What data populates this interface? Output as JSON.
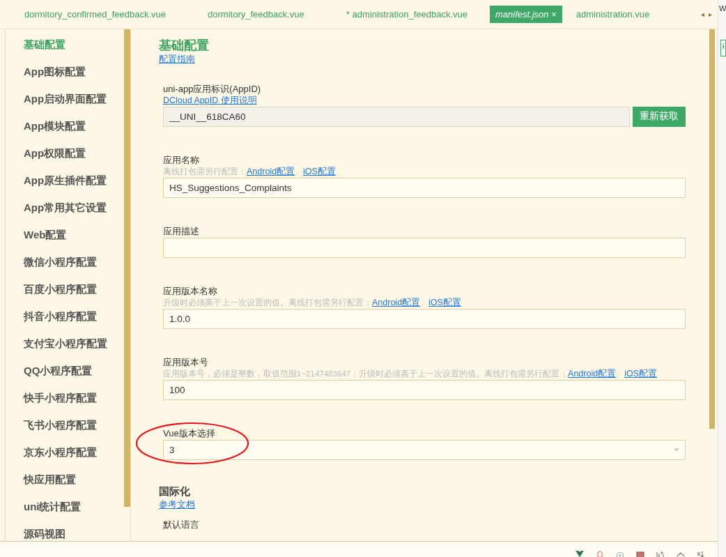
{
  "tabs": [
    {
      "label": "dormitory_confirmed_feedback.vue",
      "selected": false,
      "modified": false
    },
    {
      "label": "dormitory_feedback.vue",
      "selected": false,
      "modified": false
    },
    {
      "label": "administration_feedback.vue",
      "selected": false,
      "modified": true,
      "modified_mark": "*"
    },
    {
      "label": "manifest.json",
      "selected": true,
      "modified": false,
      "close": "×"
    },
    {
      "label": "administration.vue",
      "selected": false,
      "modified": false
    }
  ],
  "tab_arrows": [
    "◂",
    "▸"
  ],
  "side_panel": {
    "title": "W",
    "field_text": "i"
  },
  "sidebar": {
    "items": [
      {
        "label": "基础配置",
        "selected": true
      },
      {
        "label": "App图标配置",
        "selected": false
      },
      {
        "label": "App启动界面配置",
        "selected": false
      },
      {
        "label": "App模块配置",
        "selected": false
      },
      {
        "label": "App权限配置",
        "selected": false
      },
      {
        "label": "App原生插件配置",
        "selected": false
      },
      {
        "label": "App常用其它设置",
        "selected": false
      },
      {
        "label": "Web配置",
        "selected": false
      },
      {
        "label": "微信小程序配置",
        "selected": false
      },
      {
        "label": "百度小程序配置",
        "selected": false
      },
      {
        "label": "抖音小程序配置",
        "selected": false
      },
      {
        "label": "支付宝小程序配置",
        "selected": false
      },
      {
        "label": "QQ小程序配置",
        "selected": false
      },
      {
        "label": "快手小程序配置",
        "selected": false
      },
      {
        "label": "飞书小程序配置",
        "selected": false
      },
      {
        "label": "京东小程序配置",
        "selected": false
      },
      {
        "label": "快应用配置",
        "selected": false
      },
      {
        "label": "uni统计配置",
        "selected": false
      },
      {
        "label": "源码视图",
        "selected": false
      }
    ]
  },
  "sections": [
    {
      "title": "基础配置",
      "link": "配置指南",
      "fields": [
        {
          "kind": "readonly",
          "label": "uni-app应用标识(AppID)",
          "help_link": "DCloud AppID 使用说明",
          "value": "__UNI__618CA60",
          "button": "重新获取"
        },
        {
          "kind": "text",
          "label": "应用名称",
          "hint": "离线打包需另行配置：",
          "links": [
            "Android配置",
            "iOS配置"
          ],
          "separator": "、",
          "value": "HS_Suggestions_Complaints"
        },
        {
          "kind": "text",
          "label": "应用描述"
        },
        {
          "kind": "text",
          "label": "应用版本名称",
          "hint": "升级时必须高于上一次设置的值。离线打包需另行配置：",
          "links": [
            "Android配置",
            "iOS配置"
          ],
          "separator": "、",
          "value": "1.0.0"
        },
        {
          "kind": "text",
          "label": "应用版本号",
          "hint": "应用版本号，必须是整数，取值范围1~2147483647；升级时必须高于上一次设置的值。离线打包需另行配置：",
          "links": [
            "Android配置",
            "iOS配置"
          ],
          "separator": "、",
          "value": "100"
        },
        {
          "kind": "select",
          "label": "Vue版本选择",
          "value": "3",
          "highlighted": true
        }
      ]
    },
    {
      "title": "国际化",
      "link": "参考文档",
      "fields": [
        {
          "kind": "label",
          "label": "默认语言"
        }
      ]
    }
  ]
}
